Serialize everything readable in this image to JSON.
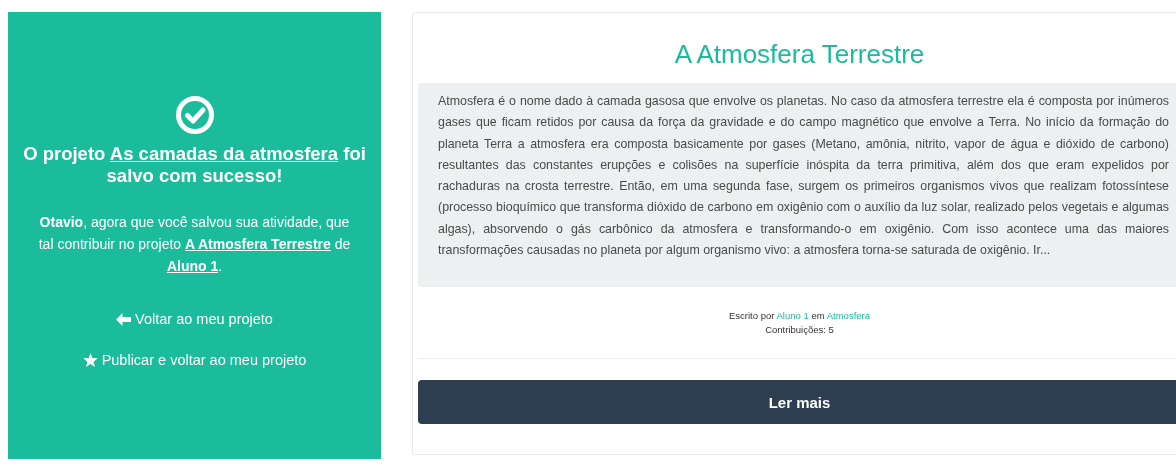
{
  "success_panel": {
    "headline_prefix": "O projeto ",
    "headline_link": "As camadas da atmosfera",
    "headline_suffix": " foi salvo com sucesso!",
    "message_intro": "**Otavio**, agora que você salvou sua atividade, que tal contribuir no projeto ",
    "message_project_link": "A Atmosfera Terrestre",
    "message_middle": " de ",
    "message_author_link": "Aluno 1",
    "message_end": ".",
    "actions": [
      {
        "kind": "back",
        "label": "Voltar ao meu projeto"
      },
      {
        "kind": "publish",
        "label": "Publicar e voltar ao meu projeto"
      }
    ]
  },
  "project_card": {
    "title": "A Atmosfera Terrestre",
    "excerpt": "Atmosfera é o nome dado à camada gasosa que envolve os planetas. No caso da atmosfera terrestre ela é composta por inúmeros gases que ficam retidos por causa da força da gravidade e do campo magnético que envolve a Terra. No início da formação do planeta Terra a atmosfera era composta basicamente por gases (Metano, amônia, nitrito, vapor de água e dióxido de carbono) resultantes das constantes erupções e colisões na superfície inóspita da terra primitiva, além dos que eram expelidos por rachaduras na crosta terrestre. Então, em uma segunda fase, surgem os primeiros organismos vivos que realizam fotossíntese  (processo bioquímico que transforma dióxido de carbono em oxigênio  com o auxílio da luz solar, realizado pelos vegetais e algumas algas), absorvendo o gás carbônico da atmosfera e transformando-o em oxigênio. Com isso acontece uma das maiores transformações causadas no planeta por algum organismo vivo: a atmosfera torna-se saturada de oxigênio. Ir...",
    "written_by": "Escrito por ",
    "author_link": "Aluno 1",
    "in": " em ",
    "category_link": "Atmosfera",
    "contributions": "Contribuições: 5",
    "button": "Ler mais"
  }
}
